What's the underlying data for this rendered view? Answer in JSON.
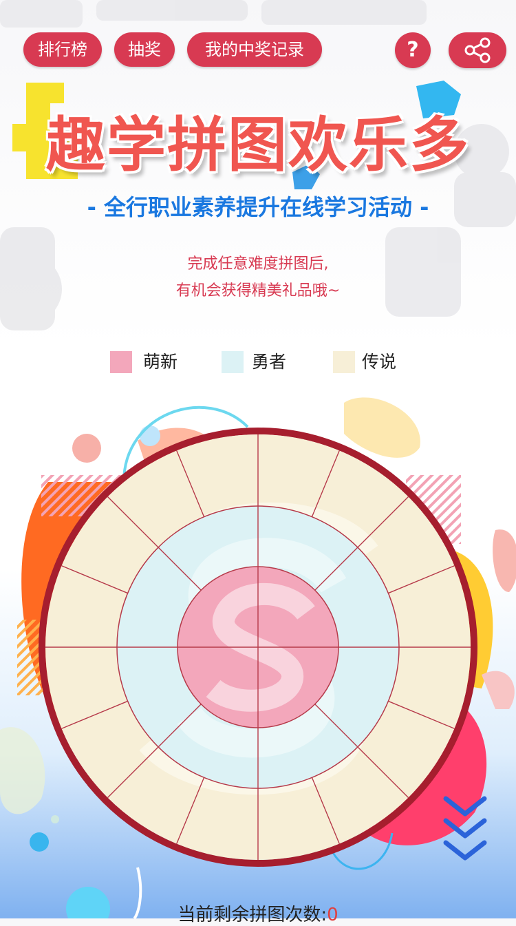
{
  "toolbar": {
    "ranking_label": "排行榜",
    "lottery_label": "抽奖",
    "records_label": "我的中奖记录",
    "help_label": "?",
    "share_icon": "share-icon"
  },
  "header": {
    "title": "趣学拼图欢乐多",
    "subtitle": "- 全行职业素养提升在线学习活动 -",
    "desc_line1": "完成任意难度拼图后,",
    "desc_line2": "有机会获得精美礼品哦~"
  },
  "legend": [
    {
      "label": "萌新",
      "color": "#f3a7bb"
    },
    {
      "label": "勇者",
      "color": "#dcf2f5"
    },
    {
      "label": "传说",
      "color": "#f7efd7"
    }
  ],
  "puzzle": {
    "ring_color": "#a61e2e",
    "outer_sectors": 16,
    "middle_sectors": 8,
    "inner_sectors": 4
  },
  "footer": {
    "remaining_label": "当前剩余拼图次数:",
    "remaining_count": "0"
  }
}
